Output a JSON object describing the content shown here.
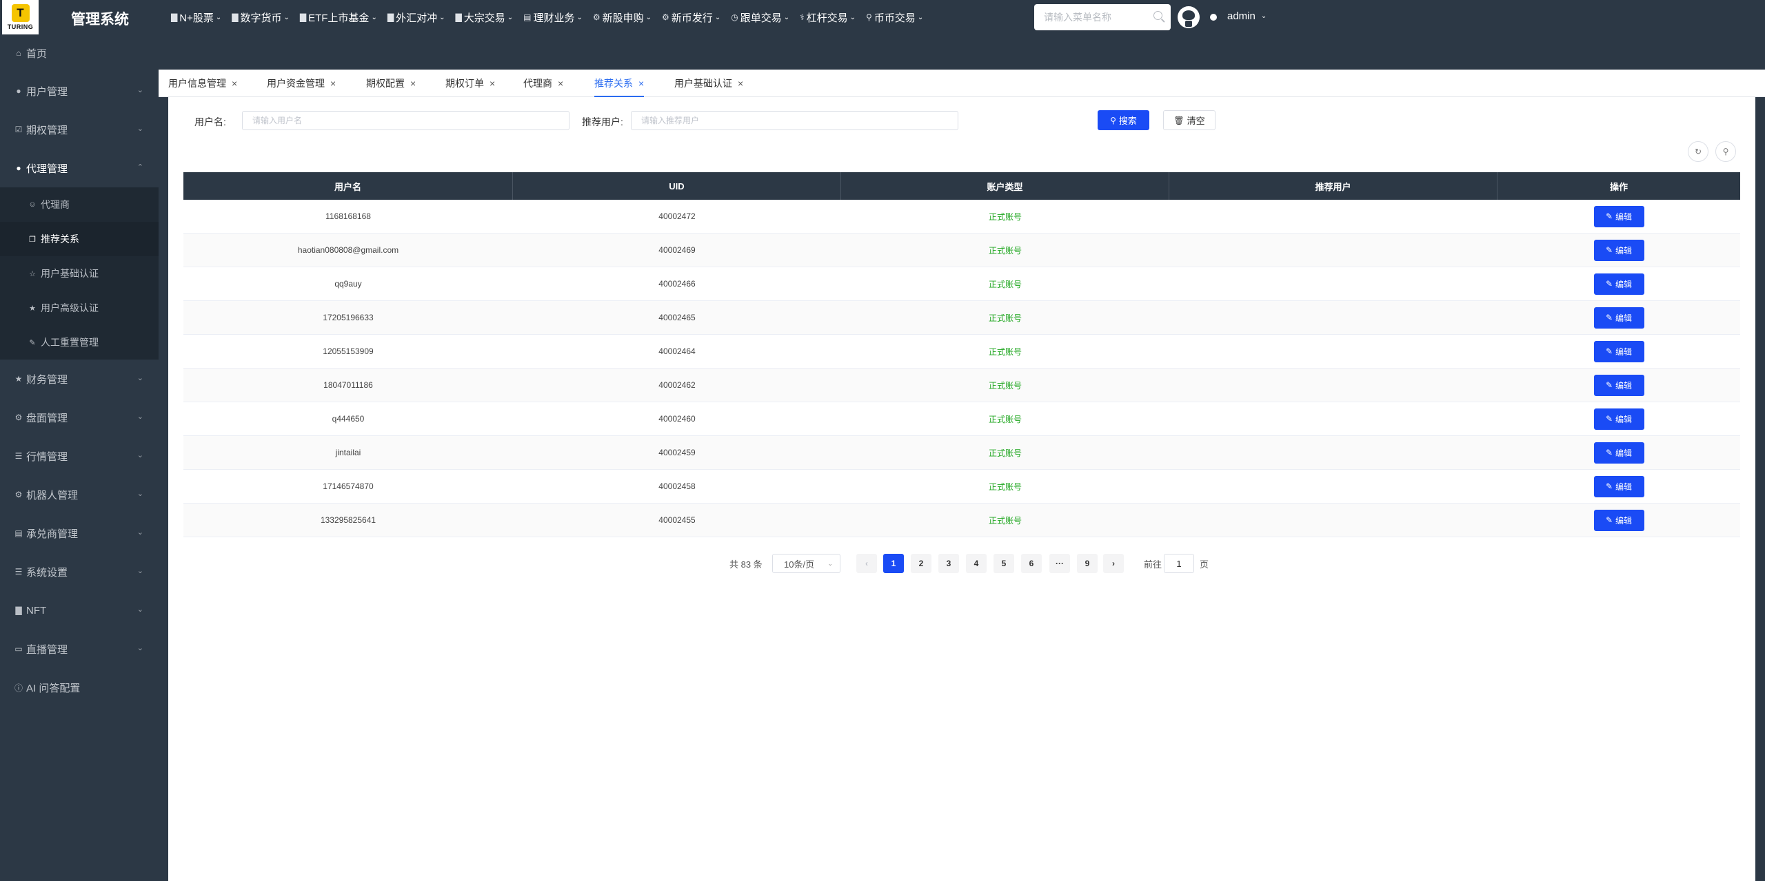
{
  "header": {
    "logo_text": "TURING",
    "brand": "管理系统",
    "nav": [
      {
        "label": "N+股票",
        "icon": "bar-chart-icon"
      },
      {
        "label": "数字货币",
        "icon": "bar-chart-icon"
      },
      {
        "label": "ETF上市基金",
        "icon": "bar-chart-icon"
      },
      {
        "label": "外汇对冲",
        "icon": "bar-chart-icon"
      },
      {
        "label": "大宗交易",
        "icon": "bar-chart-icon"
      },
      {
        "label": "理财业务",
        "icon": "document-icon"
      },
      {
        "label": "新股申购",
        "icon": "gear-icon"
      },
      {
        "label": "新币发行",
        "icon": "gear-icon"
      },
      {
        "label": "跟单交易",
        "icon": "clock-icon"
      },
      {
        "label": "杠杆交易",
        "icon": "lever-icon"
      },
      {
        "label": "币币交易",
        "icon": "pin-icon"
      }
    ],
    "menu_search_placeholder": "请输入菜单名称",
    "user": "admin"
  },
  "sidebar": {
    "home": "首页",
    "items": [
      {
        "label": "用户管理",
        "icon": "user-icon"
      },
      {
        "label": "期权管理",
        "icon": "check-square-icon"
      },
      {
        "label": "代理管理",
        "icon": "user-icon",
        "active": true
      }
    ],
    "sub_items": [
      {
        "label": "代理商",
        "icon": "person-icon"
      },
      {
        "label": "推荐关系",
        "icon": "copy-icon",
        "active": true
      },
      {
        "label": "用户基础认证",
        "icon": "star-outline-icon"
      },
      {
        "label": "用户高级认证",
        "icon": "star-icon"
      },
      {
        "label": "人工重置管理",
        "icon": "edit-icon"
      }
    ],
    "items_after": [
      {
        "label": "财务管理",
        "icon": "star-icon"
      },
      {
        "label": "盘面管理",
        "icon": "gear-icon"
      },
      {
        "label": "行情管理",
        "icon": "list-icon"
      },
      {
        "label": "机器人管理",
        "icon": "gear-icon"
      },
      {
        "label": "承兑商管理",
        "icon": "document-icon"
      },
      {
        "label": "系统设置",
        "icon": "list-icon"
      },
      {
        "label": "NFT",
        "icon": "bar-chart-icon"
      },
      {
        "label": "直播管理",
        "icon": "video-icon"
      }
    ],
    "ai_item": {
      "label": "AI 问答配置",
      "icon": "info-icon"
    }
  },
  "tabs": [
    {
      "label": "用户信息管理"
    },
    {
      "label": "用户资金管理"
    },
    {
      "label": "期权配置"
    },
    {
      "label": "期权订单"
    },
    {
      "label": "代理商"
    },
    {
      "label": "推荐关系",
      "active": true
    },
    {
      "label": "用户基础认证"
    }
  ],
  "filters": {
    "username_label": "用户名:",
    "username_placeholder": "请输入用户名",
    "referrer_label": "推荐用户:",
    "referrer_placeholder": "请输入推荐用户",
    "search_button": "搜索",
    "clear_button": "清空"
  },
  "table": {
    "columns": [
      "用户名",
      "UID",
      "账户类型",
      "推荐用户",
      "操作"
    ],
    "edit_label": "编辑",
    "rows": [
      {
        "username": "1168168168",
        "uid": "40002472",
        "type": "正式账号",
        "referrer": ""
      },
      {
        "username": "haotian080808@gmail.com",
        "uid": "40002469",
        "type": "正式账号",
        "referrer": ""
      },
      {
        "username": "qq9auy",
        "uid": "40002466",
        "type": "正式账号",
        "referrer": ""
      },
      {
        "username": "17205196633",
        "uid": "40002465",
        "type": "正式账号",
        "referrer": ""
      },
      {
        "username": "12055153909",
        "uid": "40002464",
        "type": "正式账号",
        "referrer": ""
      },
      {
        "username": "18047011186",
        "uid": "40002462",
        "type": "正式账号",
        "referrer": ""
      },
      {
        "username": "q444650",
        "uid": "40002460",
        "type": "正式账号",
        "referrer": ""
      },
      {
        "username": "jintailai",
        "uid": "40002459",
        "type": "正式账号",
        "referrer": ""
      },
      {
        "username": "17146574870",
        "uid": "40002458",
        "type": "正式账号",
        "referrer": ""
      },
      {
        "username": "133295825641",
        "uid": "40002455",
        "type": "正式账号",
        "referrer": ""
      }
    ]
  },
  "pagination": {
    "total": "共 83 条",
    "page_size": "10条/页",
    "pages": [
      "1",
      "2",
      "3",
      "4",
      "5",
      "6",
      "···",
      "9"
    ],
    "current": "1",
    "goto_label": "前往",
    "goto_value": "1",
    "page_suffix": "页"
  },
  "colors": {
    "accent": "#1a4bf5",
    "header_bg": "#2c3845",
    "account_green": "#1ea61e"
  }
}
